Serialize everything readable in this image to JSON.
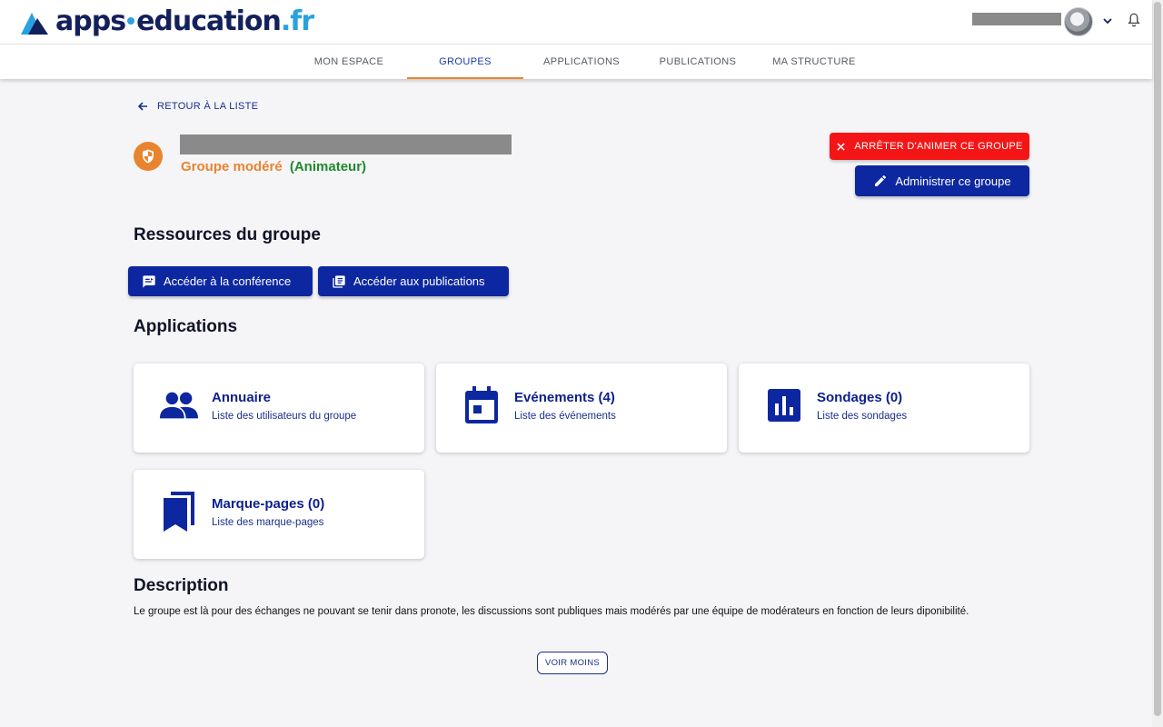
{
  "header": {
    "logo": {
      "part1": "apps",
      "part2": "education",
      "part3": ".fr"
    },
    "nav_tabs": [
      {
        "label": "MON ESPACE",
        "active": false
      },
      {
        "label": "GROUPES",
        "active": true
      },
      {
        "label": "APPLICATIONS",
        "active": false
      },
      {
        "label": "PUBLICATIONS",
        "active": false
      },
      {
        "label": "MA STRUCTURE",
        "active": false
      }
    ]
  },
  "group": {
    "back_label": "RETOUR À LA LISTE",
    "type_label": "Groupe modéré",
    "role_label": "(Animateur)",
    "stop_button": "ARRÊTER D'ANIMER CE GROUPE",
    "admin_button": "Administrer ce groupe"
  },
  "resources": {
    "title": "Ressources du groupe",
    "conference_button": "Accéder à la conférence",
    "publications_button": "Accéder aux publications"
  },
  "applications": {
    "title": "Applications",
    "cards": [
      {
        "title": "Annuaire",
        "subtitle": "Liste des utilisateurs du groupe",
        "icon": "people-icon"
      },
      {
        "title": "Evénements (4)",
        "subtitle": "Liste des événements",
        "icon": "calendar-icon"
      },
      {
        "title": "Sondages (0)",
        "subtitle": "Liste des sondages",
        "icon": "poll-icon"
      },
      {
        "title": "Marque-pages (0)",
        "subtitle": "Liste des marque-pages",
        "icon": "bookmarks-icon"
      }
    ]
  },
  "description": {
    "title": "Description",
    "text": "Le groupe est là pour des échanges ne pouvant se tenir dans pronote, les discussions sont publiques mais modérés par une équipe de modérateurs en fonction de leurs diponibilité.",
    "toggle_label": "VOIR MOINS"
  },
  "colors": {
    "primary": "#0c27a0",
    "accent": "#e8842d",
    "danger": "#f41616",
    "success": "#1f8a2b"
  }
}
